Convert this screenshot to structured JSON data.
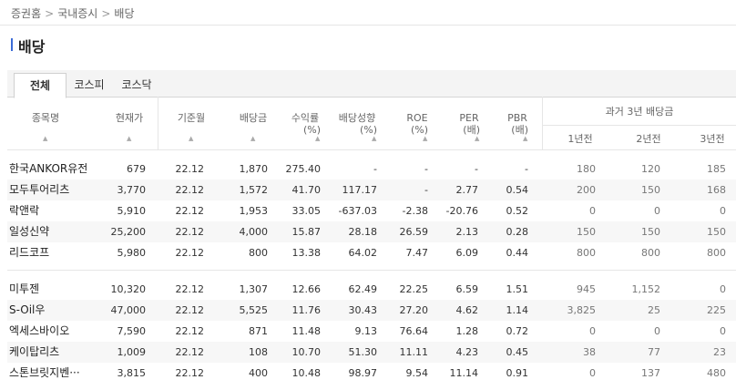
{
  "breadcrumb": [
    "증권홈",
    "국내증시",
    "배당"
  ],
  "breadcrumb_sep": ">",
  "page_title": "배당",
  "tabs": [
    {
      "label": "전체",
      "active": true
    },
    {
      "label": "코스피",
      "active": false
    },
    {
      "label": "코스닥",
      "active": false
    }
  ],
  "headers": {
    "name": "종목명",
    "price": "현재가",
    "base_month": "기준월",
    "dividend": "배당금",
    "yield_line1": "수익률",
    "yield_line2": "(%)",
    "payout_line1": "배당성향",
    "payout_line2": "(%)",
    "roe_line1": "ROE",
    "roe_line2": "(%)",
    "per_line1": "PER",
    "per_line2": "(배)",
    "pbr_line1": "PBR",
    "pbr_line2": "(배)",
    "past_group": "과거 3년 배당금",
    "past_1": "1년전",
    "past_2": "2년전",
    "past_3": "3년전",
    "sort_icon": "sort-arrow-icon"
  },
  "group1": [
    {
      "name": "한국ANKOR유전",
      "price": "679",
      "month": "22.12",
      "div": "1,870",
      "yield": "275.40",
      "payout": "-",
      "roe": "-",
      "per": "-",
      "pbr": "-",
      "p1": "180",
      "p2": "120",
      "p3": "185"
    },
    {
      "name": "모두투어리츠",
      "price": "3,770",
      "month": "22.12",
      "div": "1,572",
      "yield": "41.70",
      "payout": "117.17",
      "roe": "-",
      "per": "2.77",
      "pbr": "0.54",
      "p1": "200",
      "p2": "150",
      "p3": "168"
    },
    {
      "name": "락앤락",
      "price": "5,910",
      "month": "22.12",
      "div": "1,953",
      "yield": "33.05",
      "payout": "-637.03",
      "roe": "-2.38",
      "per": "-20.76",
      "pbr": "0.52",
      "p1": "0",
      "p2": "0",
      "p3": "0"
    },
    {
      "name": "일성신약",
      "price": "25,200",
      "month": "22.12",
      "div": "4,000",
      "yield": "15.87",
      "payout": "28.18",
      "roe": "26.59",
      "per": "2.13",
      "pbr": "0.28",
      "p1": "150",
      "p2": "150",
      "p3": "150"
    },
    {
      "name": "리드코프",
      "price": "5,980",
      "month": "22.12",
      "div": "800",
      "yield": "13.38",
      "payout": "64.02",
      "roe": "7.47",
      "per": "6.09",
      "pbr": "0.44",
      "p1": "800",
      "p2": "800",
      "p3": "800"
    }
  ],
  "group2": [
    {
      "name": "미투젠",
      "price": "10,320",
      "month": "22.12",
      "div": "1,307",
      "yield": "12.66",
      "payout": "62.49",
      "roe": "22.25",
      "per": "6.59",
      "pbr": "1.51",
      "p1": "945",
      "p2": "1,152",
      "p3": "0"
    },
    {
      "name": "S-Oil우",
      "price": "47,000",
      "month": "22.12",
      "div": "5,525",
      "yield": "11.76",
      "payout": "30.43",
      "roe": "27.20",
      "per": "4.62",
      "pbr": "1.14",
      "p1": "3,825",
      "p2": "25",
      "p3": "225"
    },
    {
      "name": "엑세스바이오",
      "price": "7,590",
      "month": "22.12",
      "div": "871",
      "yield": "11.48",
      "payout": "9.13",
      "roe": "76.64",
      "per": "1.28",
      "pbr": "0.72",
      "p1": "0",
      "p2": "0",
      "p3": "0"
    },
    {
      "name": "케이탑리츠",
      "price": "1,009",
      "month": "22.12",
      "div": "108",
      "yield": "10.70",
      "payout": "51.30",
      "roe": "11.11",
      "per": "4.23",
      "pbr": "0.45",
      "p1": "38",
      "p2": "77",
      "p3": "23"
    },
    {
      "name": "스톤브릿지벤···",
      "price": "3,815",
      "month": "22.12",
      "div": "400",
      "yield": "10.48",
      "payout": "98.97",
      "roe": "9.54",
      "per": "11.14",
      "pbr": "0.91",
      "p1": "0",
      "p2": "137",
      "p3": "480"
    }
  ]
}
